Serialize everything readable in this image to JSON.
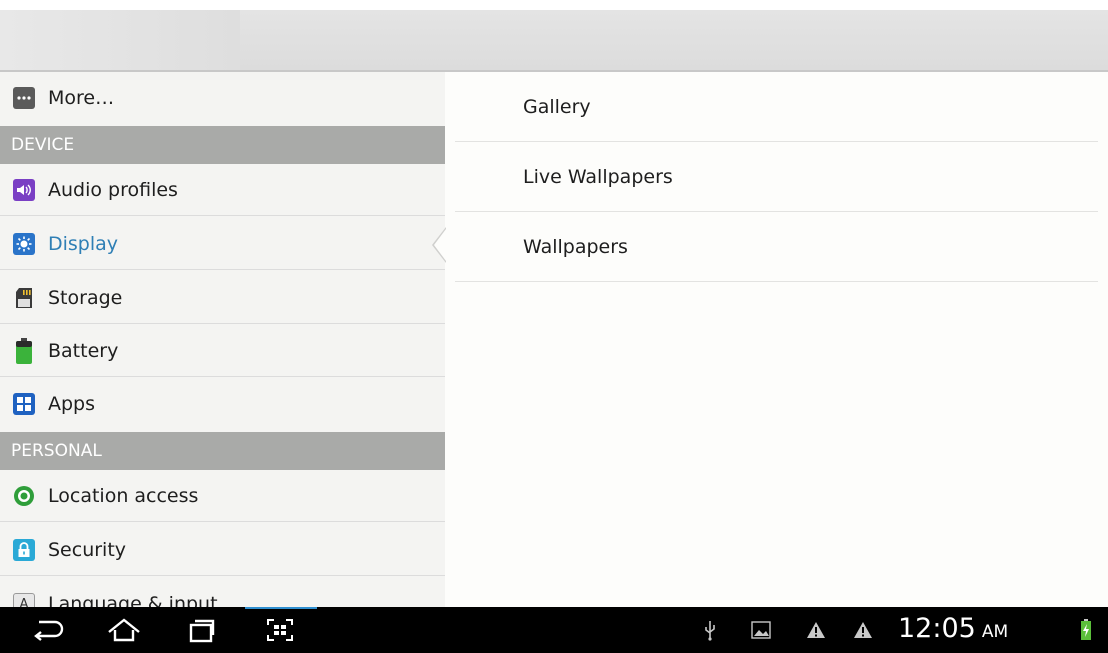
{
  "left_list": {
    "more_label": "More…",
    "device_header": "DEVICE",
    "audio_profiles_label": "Audio profiles",
    "display_label": "Display",
    "storage_label": "Storage",
    "battery_label": "Battery",
    "apps_label": "Apps",
    "personal_header": "PERSONAL",
    "location_label": "Location access",
    "security_label": "Security",
    "language_label": "Language & input",
    "language_icon_text": "A"
  },
  "right_list": {
    "items": [
      "Gallery",
      "Live Wallpapers",
      "Wallpapers"
    ]
  },
  "status_bar": {
    "time": "12:05",
    "ampm": "AM"
  },
  "colors": {
    "accent_blue": "#2f7fb5",
    "header_gray": "#a9aaa8",
    "audio_purple": "#7a3fc4",
    "display_blue": "#2a74c9",
    "apps_blue": "#1f62c1",
    "location_green": "#2f9e3a",
    "security_cyan": "#2aa9d6",
    "battery_green": "#3bb33b"
  }
}
